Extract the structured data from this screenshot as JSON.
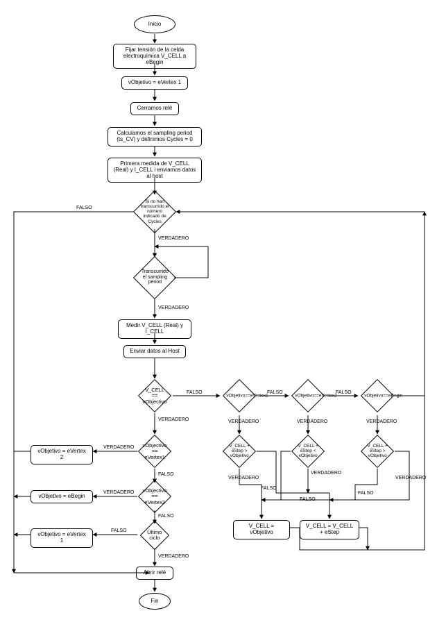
{
  "terminator_start": "Inicio",
  "terminator_end": "Fin",
  "process": {
    "fix_voltage": "Fijar tensión de la celda electroquímica V_CELL a eBegin",
    "vobj_evertex1": "vObjetivo = eVertex 1",
    "close_relay": "Cerramos relé",
    "calc_sampling": "Calculamos el sampling period (ts_CV) y definimos Cycles = 0",
    "first_measure": "Primera medida de V_CELL (Real) y I_CELL i enviamos datos al host",
    "measure": "Medir V_CELL (Real) y I_CELL",
    "send_host": "Enviar datos al Host",
    "vobj_evertex2": "vObjetivo = eVertex 2",
    "vobj_ebegin": "vObjetivo = eBegin",
    "vobj_evertex1b": "vObjetivo = eVertex 1",
    "vcell_vobj": "V_CELL = vObjetivo",
    "vcell_estep": "V_CELL = V_CELL + eStep",
    "open_relay": "Abrir relé"
  },
  "decision": {
    "cycles_done": "Si no han transcurrido el número indicado de Cycles",
    "sampling_elapsed": "Transcurrido el sampling period",
    "vcell_eq_vobj": "V_CELL == vObjectivo",
    "vobj_eq_evertex1": "vObjectivo == eVertex1",
    "vobj_eq_evertex2": "vObjectivo == eVertex2",
    "last_cycle": "Último ciclo",
    "vobj_eq_evertex1_r": "vObjetivo==eVertex1",
    "vobj_eq_evertex2_r": "vObjetivo==eVertex2",
    "vobj_eq_ebegin_r": "vObjetivo==eBegin",
    "vcell_plus_gt_a": "V_CELL + eStep > vObjetivo",
    "vcell_plus_lt": "V_CELL + eStep < vObjetivo",
    "vcell_plus_gt_b": "V_CELL + eStep > vObjetivo"
  },
  "labels": {
    "true": "VERDADERO",
    "false": "FALSO"
  }
}
